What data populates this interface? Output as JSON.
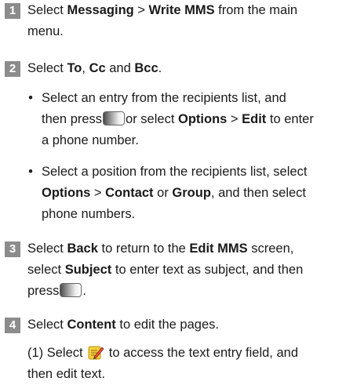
{
  "steps": [
    {
      "num": "1",
      "line1": {
        "pre": "Select ",
        "b1": "Messaging",
        "sep": " > ",
        "b2": "Write MMS",
        "post": " from the main"
      },
      "line2": "menu."
    },
    {
      "num": "2",
      "line1": {
        "pre": "Select ",
        "b1": "To",
        "t1": ", ",
        "b2": "Cc",
        "t2": " and ",
        "b3": "Bcc",
        "post": "."
      },
      "bullets": [
        {
          "mark": "•",
          "line1": "Select an entry from the recipients list, and",
          "line2": {
            "pre": "then press",
            "post": "or select ",
            "b1": "Options",
            "sep": " > ",
            "b2": "Edit",
            "post2": " to enter"
          },
          "line3": "a phone number."
        },
        {
          "mark": "•",
          "line1": "Select a position from the recipients list, select",
          "line2": {
            "b1": "Options",
            "sep": " > ",
            "b2": "Contact",
            "t1": " or ",
            "b3": "Group",
            "post": ", and then select"
          },
          "line3": "phone numbers."
        }
      ]
    },
    {
      "num": "3",
      "line1": {
        "pre": "Select ",
        "b1": "Back",
        "t1": " to return to the ",
        "b2": "Edit MMS",
        "post": " screen,"
      },
      "line2": {
        "pre": "select ",
        "b1": "Subject",
        "post": " to enter text as subject, and then"
      },
      "line3": {
        "pre": "press",
        "post": "."
      }
    },
    {
      "num": "4",
      "line1": {
        "pre": "Select ",
        "b1": "Content",
        "post": " to edit the pages."
      },
      "sub": {
        "line1": {
          "pre": "(1) Select ",
          "post": " to access the text entry field, and"
        },
        "line2": "then edit text."
      }
    }
  ],
  "icons": {
    "key": "navigation-key-icon",
    "edit": "edit-text-icon"
  },
  "colors": {
    "step_badge": "#8c8c8c",
    "text": "#1a1a1a"
  }
}
